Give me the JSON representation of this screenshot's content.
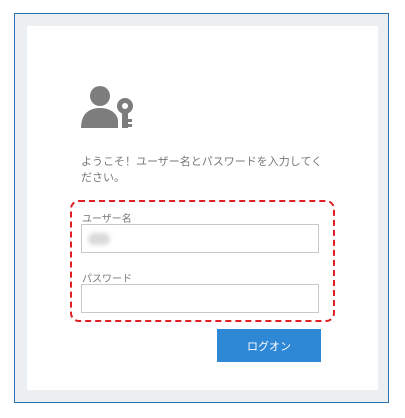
{
  "welcome_text": "ようこそ！ユーザー名とパスワードを入力してください。",
  "username": {
    "label": "ユーザー名",
    "value": ""
  },
  "password": {
    "label": "パスワード",
    "value": ""
  },
  "logon_button_label": "ログオン",
  "icons": {
    "header": "user-key-icon"
  },
  "colors": {
    "frame_border": "#2f6fb3",
    "highlight": "#e01f25",
    "button": "#2f88d6"
  }
}
